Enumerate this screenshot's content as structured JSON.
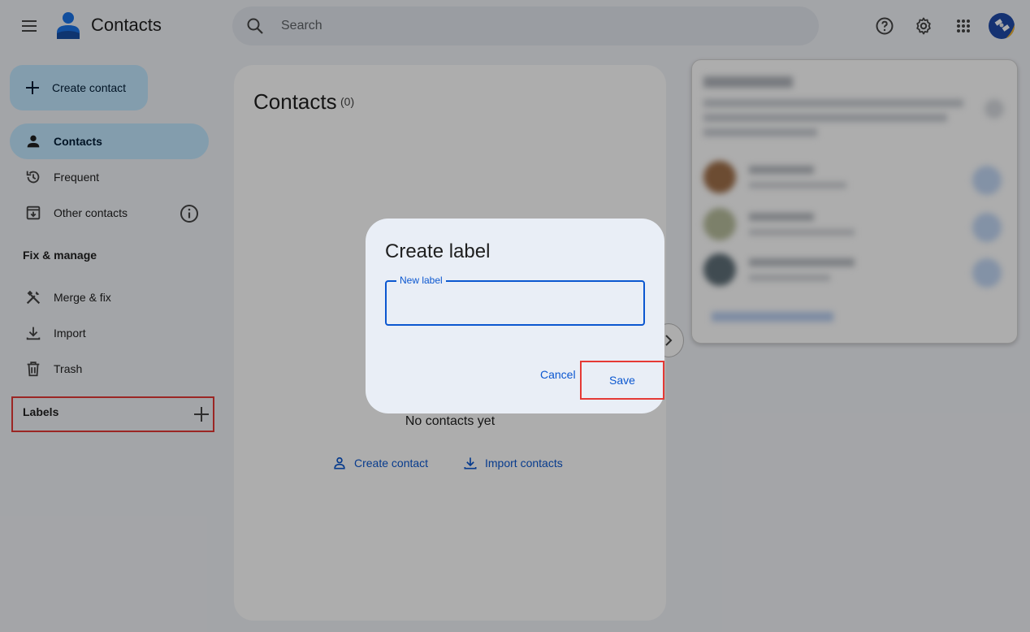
{
  "header": {
    "app_title": "Contacts",
    "search_placeholder": "Search",
    "icons": [
      "menu-icon",
      "contacts-logo-icon",
      "search-icon",
      "help-icon",
      "gear-icon",
      "apps-grid-icon",
      "avatar"
    ]
  },
  "sidebar": {
    "create_label": "Create contact",
    "items": [
      {
        "label": "Contacts",
        "icon": "person-icon",
        "active": true
      },
      {
        "label": "Frequent",
        "icon": "history-icon"
      },
      {
        "label": "Other contacts",
        "icon": "archive-icon"
      }
    ],
    "fix_manage_title": "Fix & manage",
    "manage_items": [
      {
        "label": "Merge & fix",
        "icon": "tools-icon"
      },
      {
        "label": "Import",
        "icon": "download-icon"
      },
      {
        "label": "Trash",
        "icon": "trash-icon"
      }
    ],
    "labels_title": "Labels"
  },
  "main": {
    "title": "Contacts",
    "count": "(0)",
    "empty_text": "No contacts yet",
    "create_link": "Create contact",
    "import_link": "Import contacts"
  },
  "dialog": {
    "title": "Create label",
    "field_label": "New label",
    "field_value": "",
    "cancel_label": "Cancel",
    "save_label": "Save"
  },
  "colors": {
    "accent": "#0b57d0",
    "active_nav": "#c2e7ff",
    "highlight_box": "#e53935",
    "dialog_bg": "#e9eef6"
  }
}
